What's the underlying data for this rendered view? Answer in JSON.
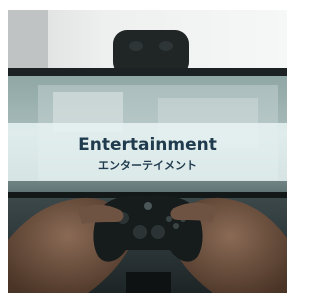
{
  "card": {
    "title": "Entertainment",
    "subtitle": "エンターテイメント"
  },
  "colors": {
    "band_overlay": "#e8f3f3",
    "text": "#1f3b4d"
  },
  "image": {
    "subject": "hands holding a game controller in front of a TV"
  }
}
